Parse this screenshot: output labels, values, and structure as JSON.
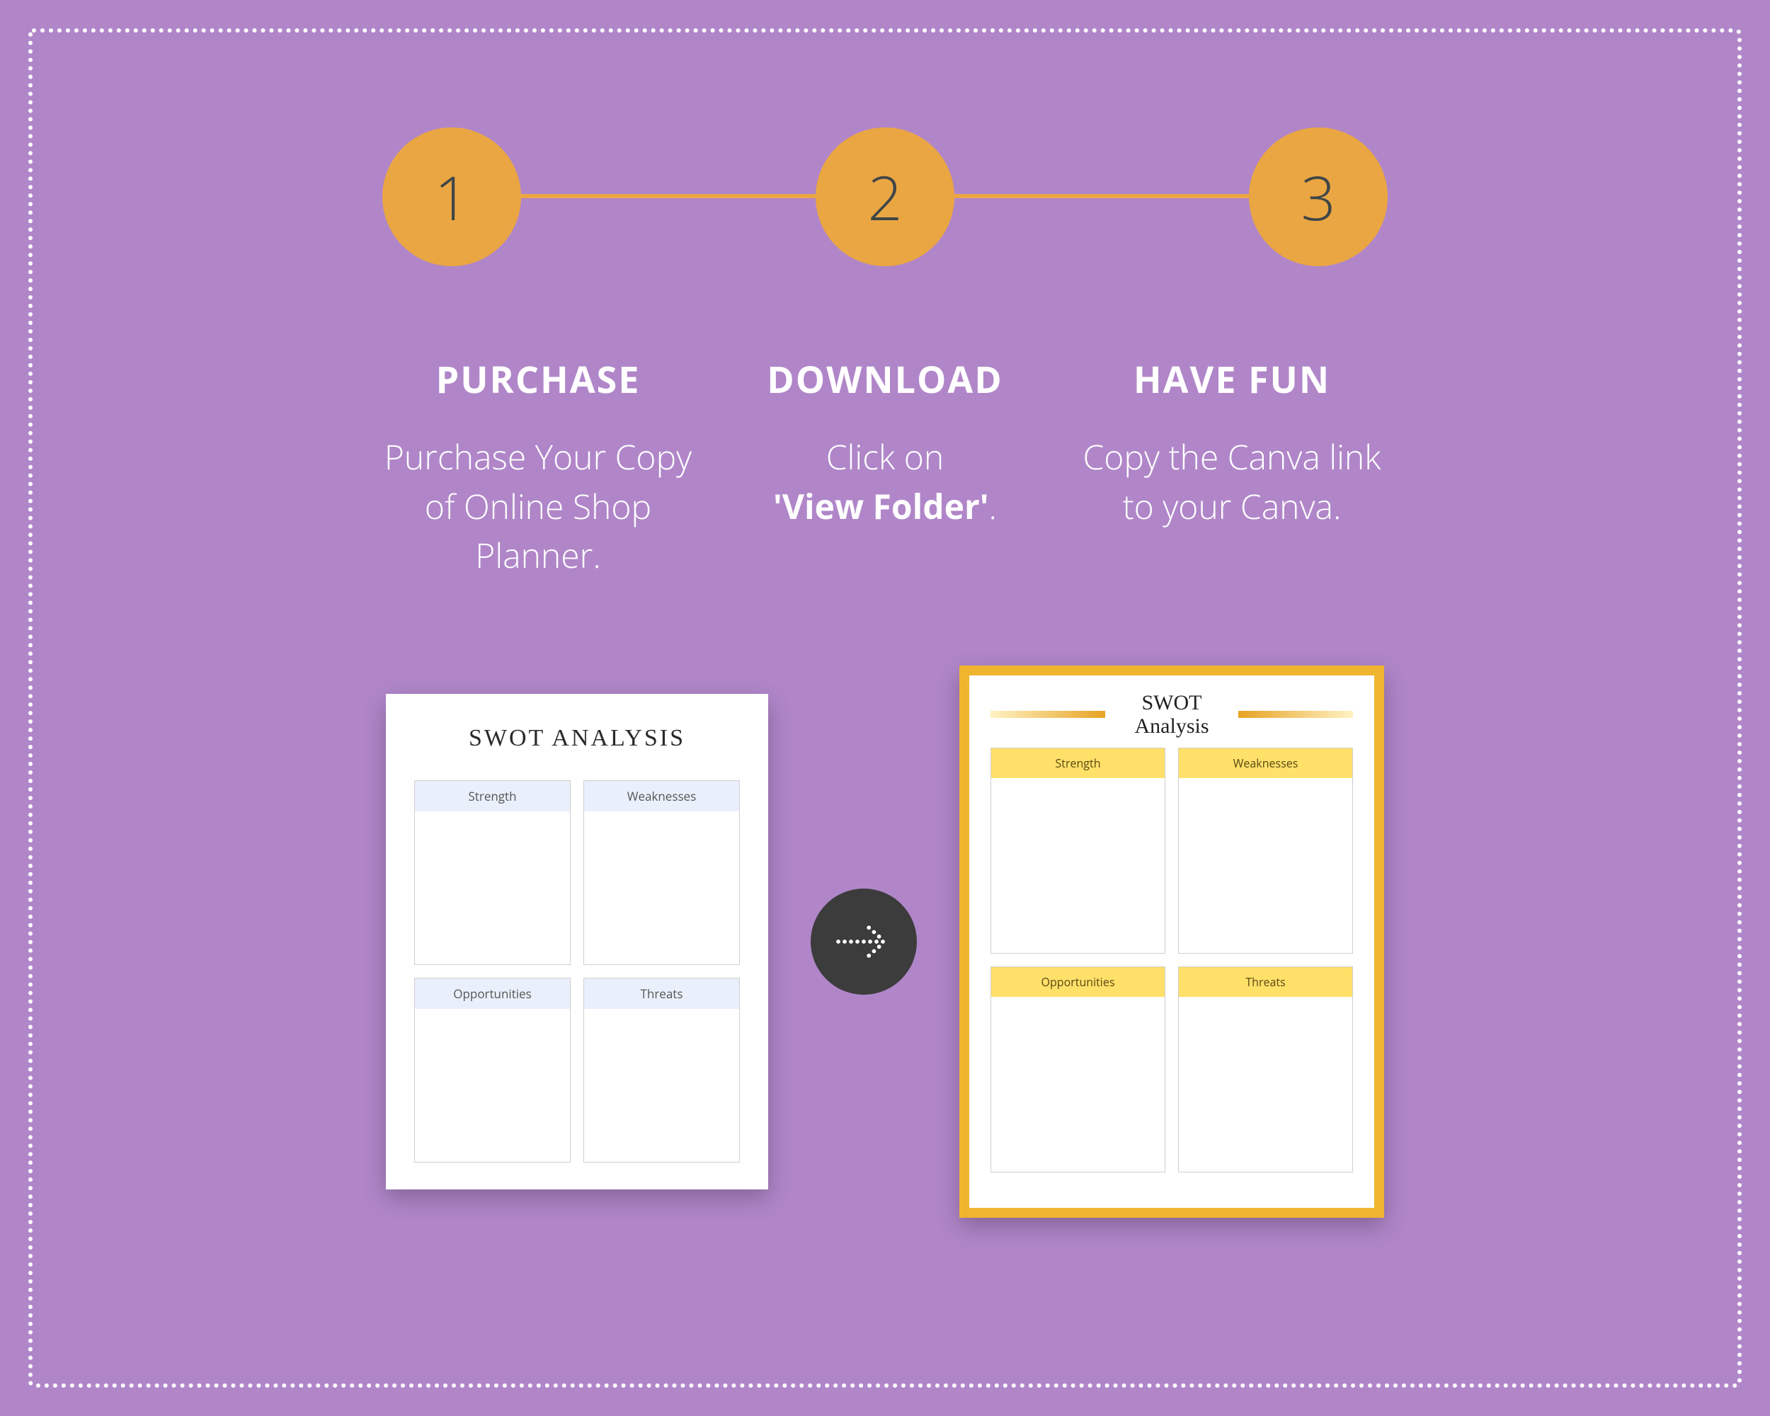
{
  "steps": [
    {
      "number": "1",
      "title": "PURCHASE",
      "desc": "Purchase Your Copy of Online Shop Planner."
    },
    {
      "number": "2",
      "title": "DOWNLOAD",
      "desc_prefix": "Click  on ",
      "desc_bold": "'View Folder'",
      "desc_suffix": "."
    },
    {
      "number": "3",
      "title": "HAVE FUN",
      "desc": "Copy the Canva link to your Canva."
    }
  ],
  "preview_left": {
    "title": "SWOT ANALYSIS",
    "quadrants": [
      "Strength",
      "Weaknesses",
      "Opportunities",
      "Threats"
    ]
  },
  "preview_right": {
    "title_line1": "SWOT",
    "title_line2": "Analysis",
    "quadrants": [
      "Strength",
      "Weaknesses",
      "Opportunities",
      "Threats"
    ]
  },
  "colors": {
    "background": "#b086c9",
    "accent": "#eaa642",
    "yellow": "#ffe069",
    "dark": "#3c3c3c"
  }
}
